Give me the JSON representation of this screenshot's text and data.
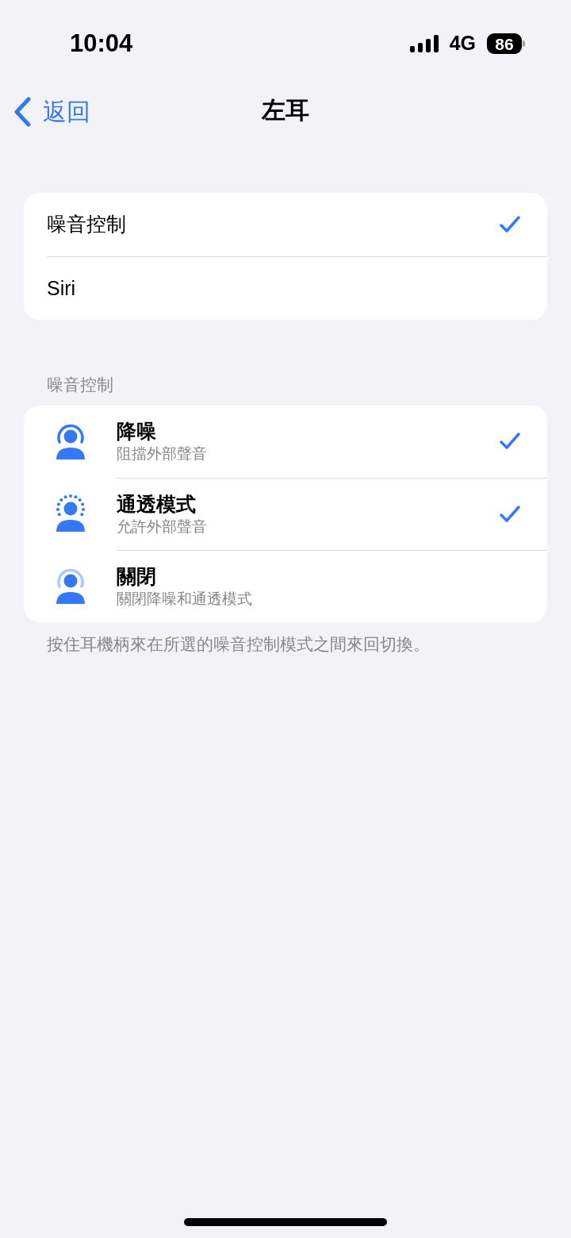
{
  "status_bar": {
    "time": "10:04",
    "network": "4G",
    "battery": "86"
  },
  "nav": {
    "back": "返回",
    "title": "左耳"
  },
  "press_hold": [
    {
      "label": "噪音控制",
      "checked": true
    },
    {
      "label": "Siri",
      "checked": false
    }
  ],
  "noise_control": {
    "header": "噪音控制",
    "modes": [
      {
        "kind": "noise",
        "title": "降噪",
        "subtitle": "阻擋外部聲音",
        "checked": true
      },
      {
        "kind": "transparency",
        "title": "通透模式",
        "subtitle": "允許外部聲音",
        "checked": true
      },
      {
        "kind": "off",
        "title": "關閉",
        "subtitle": "關閉降噪和通透模式",
        "checked": false
      }
    ],
    "footer": "按住耳機柄來在所選的噪音控制模式之間來回切換。"
  }
}
